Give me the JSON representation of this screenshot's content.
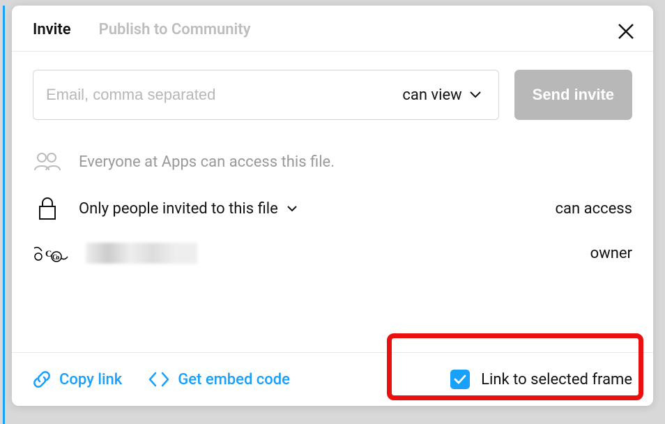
{
  "tabs": {
    "invite": "Invite",
    "publish": "Publish to Community"
  },
  "invite": {
    "email_placeholder": "Email, comma separated",
    "permission_selected": "can view",
    "send_label": "Send invite"
  },
  "access": {
    "org_text": "Everyone at Apps can access this file.",
    "scope_label": "Only people invited to this file",
    "scope_right": "can access"
  },
  "user": {
    "role": "owner"
  },
  "footer": {
    "copy_link": "Copy link",
    "embed": "Get embed code",
    "link_selected": "Link to selected frame"
  }
}
